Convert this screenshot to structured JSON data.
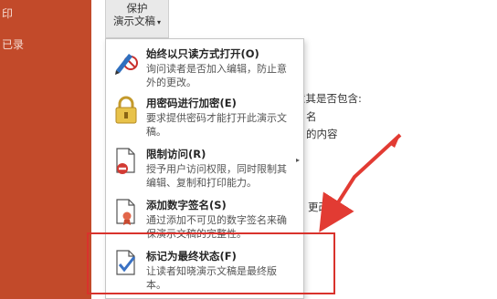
{
  "sidebar": {
    "items": [
      "印",
      "已录"
    ]
  },
  "protect_button": {
    "line1": "保护",
    "line2": "演示文稿",
    "caret": "▾"
  },
  "background_text": [
    "意其是否包含:",
    "名",
    "的内容",
    "更改。"
  ],
  "menu": {
    "items": [
      {
        "title": "始终以只读方式打开(O)",
        "desc": "询问读者是否加入编辑，防止意外的更改。",
        "icon": "pen-no-edit-icon"
      },
      {
        "title": "用密码进行加密(E)",
        "desc": "要求提供密码才能打开此演示文稿。",
        "icon": "lock-icon"
      },
      {
        "title": "限制访问(R)",
        "desc": "授予用户访问权限，同时限制其编辑、复制和打印能力。",
        "icon": "restrict-document-icon",
        "submenu_arrow": "▸"
      },
      {
        "title": "添加数字签名(S)",
        "desc": "通过添加不可见的数字签名来确保演示文稿的完整性。",
        "icon": "digital-signature-icon"
      },
      {
        "title": "标记为最终状态(F)",
        "desc": "让读者知晓演示文稿是最终版本。",
        "icon": "mark-final-icon"
      }
    ]
  },
  "colors": {
    "sidebar": "#c24a2a",
    "highlight": "#d9322c",
    "annotation_arrow": "#e23b33"
  }
}
